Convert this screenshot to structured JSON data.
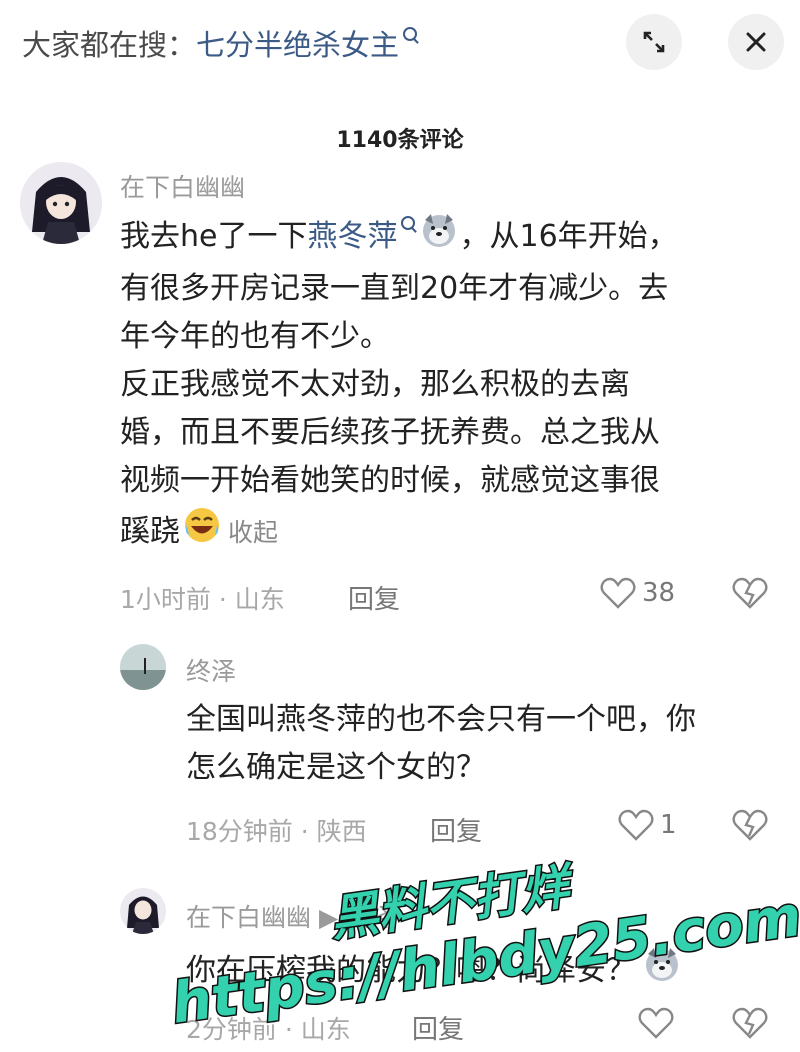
{
  "header": {
    "search_prefix": "大家都在搜：",
    "search_term": "七分半绝杀女主",
    "icons": [
      "collapse-icon",
      "close-icon"
    ]
  },
  "comments_count": "1140条评论",
  "comments": [
    {
      "user": "在下白幽幽",
      "text_lines": [
        [
          "我去he了一下",
          "燕冬萍",
          "，从16年开始，"
        ],
        "有很多开房记录一直到20年才有减少。去",
        "年今年的也有不少。",
        "反正我感觉不太对劲，那么积极的去离",
        "婚，而且不要后续孩子抚养费。总之我从",
        "视频一开始看她笑的时候，就感觉这事很",
        "蹊跷"
      ],
      "collapse_label": "收起",
      "time_location": "1小时前 · 山东",
      "reply_label": "回复",
      "likes": "38"
    }
  ],
  "replies": [
    {
      "user": "终泽",
      "text_line1": "全国叫燕冬萍的也不会只有一个吧，你",
      "text_line2": "怎么确定是这个女的？",
      "time_location": "18分钟前 · 陕西",
      "reply_label": "回复",
      "likes": "1"
    },
    {
      "user": "在下白幽幽",
      "user_suffix": "▶ 终泽",
      "text": "你在压榨我的能力？嗯？尚泽安？",
      "time_location": "2分钟前 · 山东",
      "reply_label": "回复"
    }
  ],
  "watermark": {
    "line1": "黑料不打烊",
    "line2": "https://hlbdy25.com"
  }
}
